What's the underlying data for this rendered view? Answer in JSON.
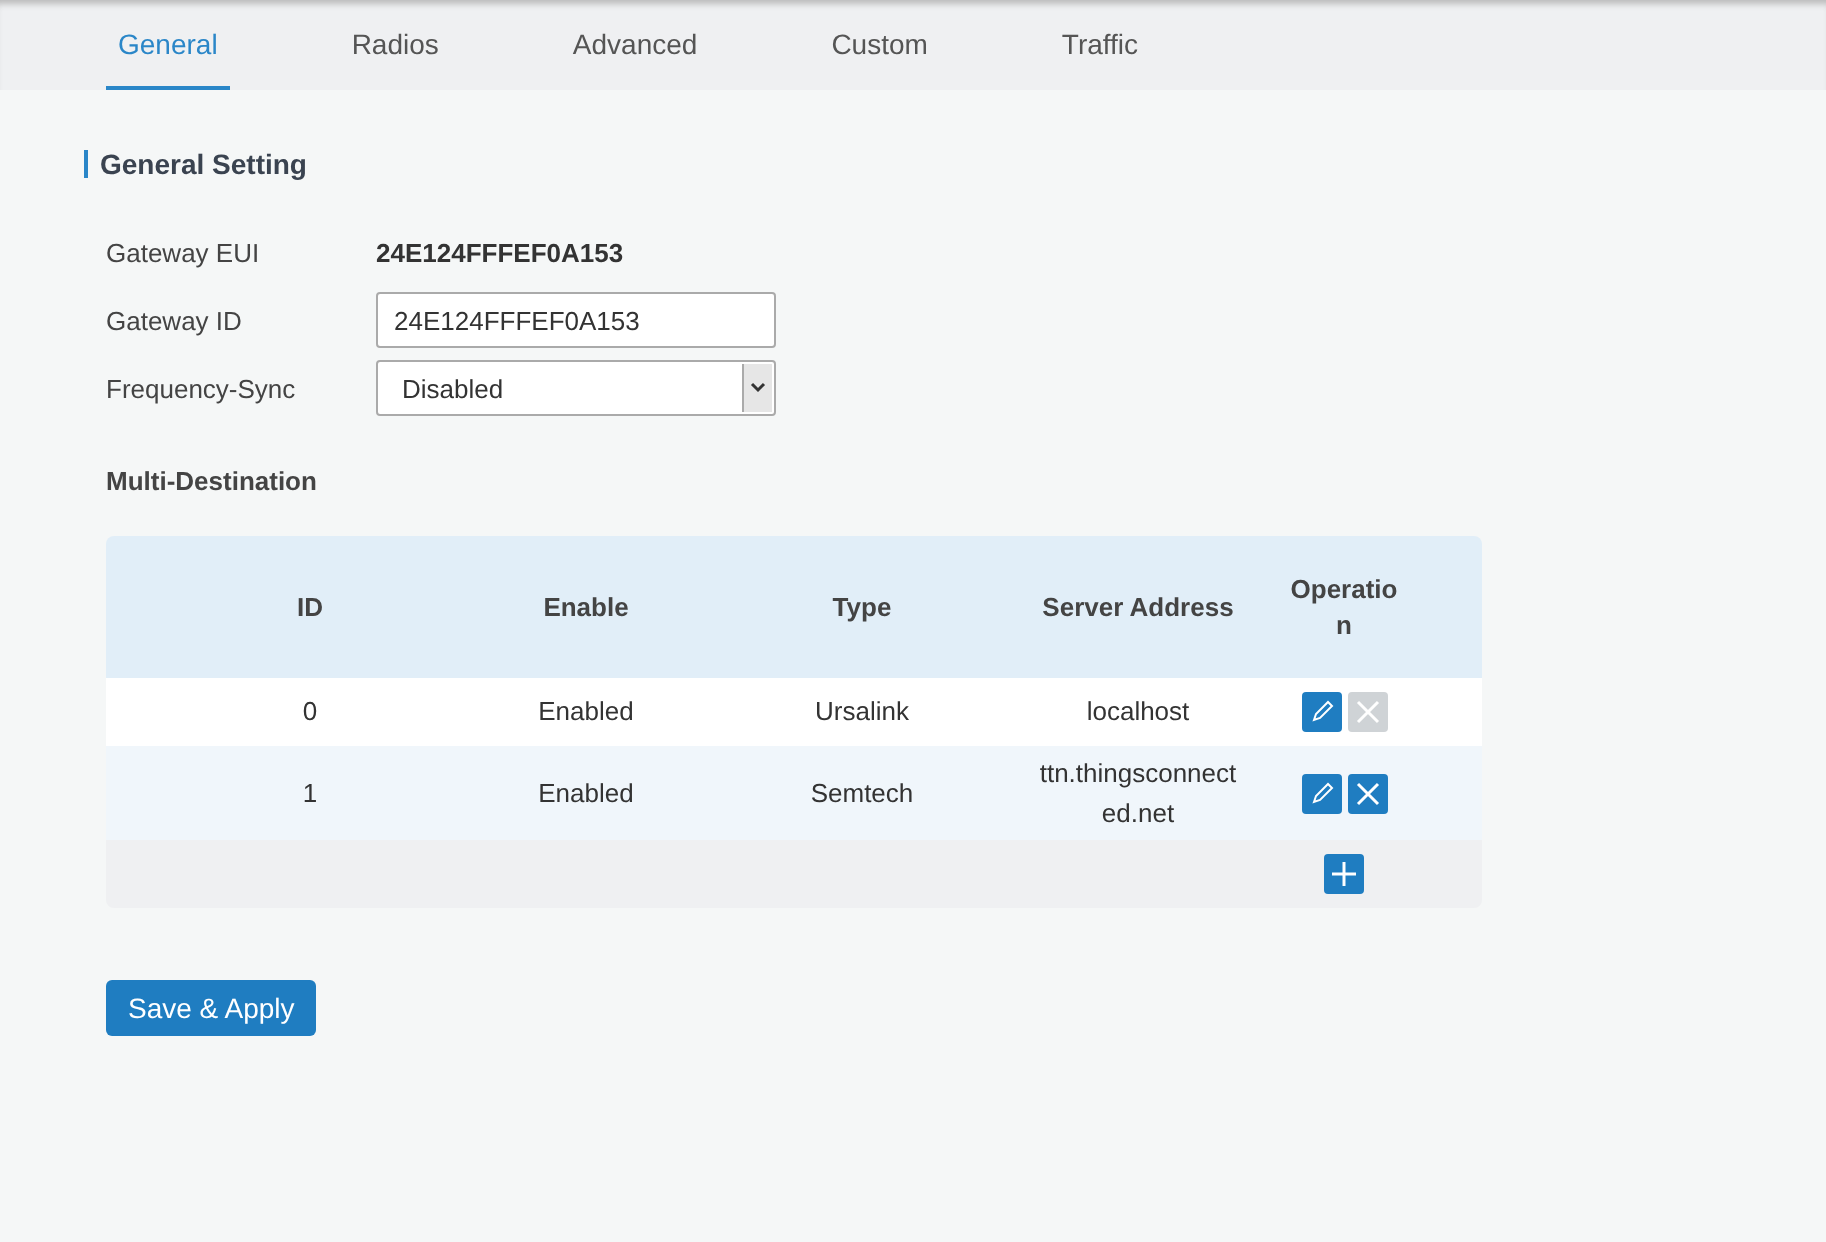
{
  "tabs": [
    {
      "label": "General",
      "selected": true
    },
    {
      "label": "Radios",
      "selected": false
    },
    {
      "label": "Advanced",
      "selected": false
    },
    {
      "label": "Custom",
      "selected": false
    },
    {
      "label": "Traffic",
      "selected": false
    }
  ],
  "section_title": "General Setting",
  "fields": [
    {
      "kind": "static",
      "label": "Gateway EUI",
      "value": "24E124FFFEF0A153"
    },
    {
      "kind": "input",
      "label": "Gateway ID",
      "value": "24E124FFFEF0A153"
    },
    {
      "kind": "select",
      "label": "Frequency-Sync",
      "value": "Disabled"
    }
  ],
  "subsection_title": "Multi-Destination",
  "table": {
    "columns": [
      "ID",
      "Enable",
      "Type",
      "Server Address",
      "Operation"
    ],
    "rows": [
      {
        "cells": [
          "0",
          "Enabled",
          "Ursalink",
          "localhost"
        ],
        "delete_disabled": true
      },
      {
        "cells": [
          "1",
          "Enabled",
          "Semtech",
          "ttn.thingsconnected.net"
        ],
        "delete_disabled": false
      }
    ]
  },
  "save_button": "Save & Apply"
}
